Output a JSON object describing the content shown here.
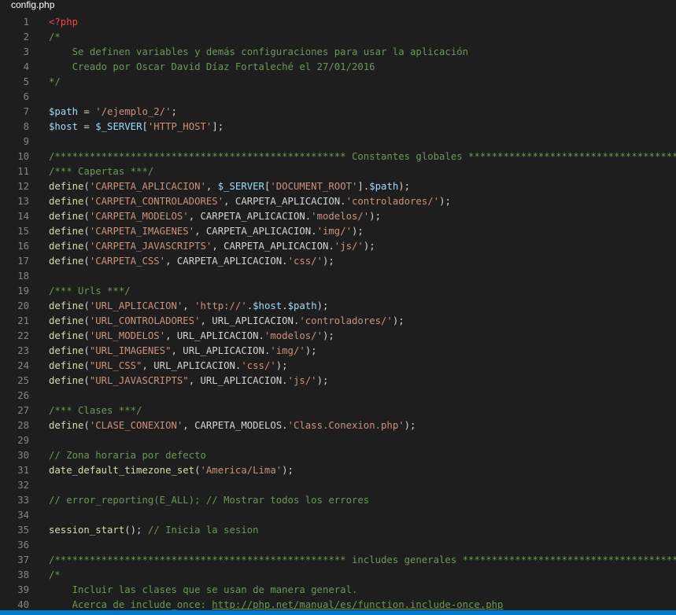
{
  "tab": {
    "title": "config.php"
  },
  "colors": {
    "background": "#1e1e1e",
    "line_number": "#858585",
    "comment": "#6a9955",
    "string": "#ce9178",
    "variable": "#9cdcfe",
    "php_tag": "#f44747",
    "function": "#dcdcaa",
    "text": "#d4d4d4",
    "statusbar": "#007acc"
  },
  "lines": [
    {
      "n": "1",
      "tokens": [
        [
          "tag",
          "<?php"
        ]
      ]
    },
    {
      "n": "2",
      "tokens": [
        [
          "cmt",
          "/*"
        ]
      ]
    },
    {
      "n": "3",
      "tokens": [
        [
          "cmt",
          "    Se definen variables y demás configuraciones para usar la aplicación"
        ]
      ]
    },
    {
      "n": "4",
      "tokens": [
        [
          "cmt",
          "    Creado por Oscar David Díaz Fortaleché el 27/01/2016"
        ]
      ]
    },
    {
      "n": "5",
      "tokens": [
        [
          "cmt",
          "*/"
        ]
      ]
    },
    {
      "n": "6",
      "tokens": []
    },
    {
      "n": "7",
      "tokens": [
        [
          "var",
          "$path"
        ],
        [
          "op",
          " = "
        ],
        [
          "str",
          "'/ejemplo_2/'"
        ],
        [
          "op",
          ";"
        ]
      ]
    },
    {
      "n": "8",
      "tokens": [
        [
          "var",
          "$host"
        ],
        [
          "op",
          " = "
        ],
        [
          "var",
          "$_SERVER"
        ],
        [
          "op",
          "["
        ],
        [
          "str",
          "'HTTP_HOST'"
        ],
        [
          "op",
          "];"
        ]
      ]
    },
    {
      "n": "9",
      "tokens": []
    },
    {
      "n": "10",
      "tokens": [
        [
          "cmt",
          "/************************************************** Constantes globales **************************************************/"
        ]
      ]
    },
    {
      "n": "11",
      "tokens": [
        [
          "cmt",
          "/*** Capertas ***/"
        ]
      ]
    },
    {
      "n": "12",
      "tokens": [
        [
          "fn",
          "define"
        ],
        [
          "op",
          "("
        ],
        [
          "str",
          "'CARPETA_APLICACION'"
        ],
        [
          "op",
          ", "
        ],
        [
          "var",
          "$_SERVER"
        ],
        [
          "op",
          "["
        ],
        [
          "str",
          "'DOCUMENT_ROOT'"
        ],
        [
          "op",
          "]."
        ],
        [
          "var",
          "$path"
        ],
        [
          "op",
          ");"
        ]
      ]
    },
    {
      "n": "13",
      "tokens": [
        [
          "fn",
          "define"
        ],
        [
          "op",
          "("
        ],
        [
          "str",
          "'CARPETA_CONTROLADORES'"
        ],
        [
          "op",
          ", CARPETA_APLICACION."
        ],
        [
          "str",
          "'controladores/'"
        ],
        [
          "op",
          ");"
        ]
      ]
    },
    {
      "n": "14",
      "tokens": [
        [
          "fn",
          "define"
        ],
        [
          "op",
          "("
        ],
        [
          "str",
          "'CARPETA_MODELOS'"
        ],
        [
          "op",
          ", CARPETA_APLICACION."
        ],
        [
          "str",
          "'modelos/'"
        ],
        [
          "op",
          ");"
        ]
      ]
    },
    {
      "n": "15",
      "tokens": [
        [
          "fn",
          "define"
        ],
        [
          "op",
          "("
        ],
        [
          "str",
          "'CARPETA_IMAGENES'"
        ],
        [
          "op",
          ", CARPETA_APLICACION."
        ],
        [
          "str",
          "'img/'"
        ],
        [
          "op",
          ");"
        ]
      ]
    },
    {
      "n": "16",
      "tokens": [
        [
          "fn",
          "define"
        ],
        [
          "op",
          "("
        ],
        [
          "str",
          "'CARPETA_JAVASCRIPTS'"
        ],
        [
          "op",
          ", CARPETA_APLICACION."
        ],
        [
          "str",
          "'js/'"
        ],
        [
          "op",
          ");"
        ]
      ]
    },
    {
      "n": "17",
      "tokens": [
        [
          "fn",
          "define"
        ],
        [
          "op",
          "("
        ],
        [
          "str",
          "'CARPETA_CSS'"
        ],
        [
          "op",
          ", CARPETA_APLICACION."
        ],
        [
          "str",
          "'css/'"
        ],
        [
          "op",
          ");"
        ]
      ]
    },
    {
      "n": "18",
      "tokens": []
    },
    {
      "n": "19",
      "tokens": [
        [
          "cmt",
          "/*** Urls ***/"
        ]
      ]
    },
    {
      "n": "20",
      "tokens": [
        [
          "fn",
          "define"
        ],
        [
          "op",
          "("
        ],
        [
          "str",
          "'URL_APLICACION'"
        ],
        [
          "op",
          ", "
        ],
        [
          "str",
          "'http://'"
        ],
        [
          "op",
          "."
        ],
        [
          "var",
          "$host"
        ],
        [
          "op",
          "."
        ],
        [
          "var",
          "$path"
        ],
        [
          "op",
          ");"
        ]
      ]
    },
    {
      "n": "21",
      "tokens": [
        [
          "fn",
          "define"
        ],
        [
          "op",
          "("
        ],
        [
          "str",
          "'URL_CONTROLADORES'"
        ],
        [
          "op",
          ", URL_APLICACION."
        ],
        [
          "str",
          "'controladores/'"
        ],
        [
          "op",
          ");"
        ]
      ]
    },
    {
      "n": "22",
      "tokens": [
        [
          "fn",
          "define"
        ],
        [
          "op",
          "("
        ],
        [
          "str",
          "'URL_MODELOS'"
        ],
        [
          "op",
          ", URL_APLICACION."
        ],
        [
          "str",
          "'modelos/'"
        ],
        [
          "op",
          ");"
        ]
      ]
    },
    {
      "n": "23",
      "tokens": [
        [
          "fn",
          "define"
        ],
        [
          "op",
          "("
        ],
        [
          "str",
          "\"URL_IMAGENES\""
        ],
        [
          "op",
          ", URL_APLICACION."
        ],
        [
          "str",
          "'img/'"
        ],
        [
          "op",
          ");"
        ]
      ]
    },
    {
      "n": "24",
      "tokens": [
        [
          "fn",
          "define"
        ],
        [
          "op",
          "("
        ],
        [
          "str",
          "\"URL_CSS\""
        ],
        [
          "op",
          ", URL_APLICACION."
        ],
        [
          "str",
          "'css/'"
        ],
        [
          "op",
          ");"
        ]
      ]
    },
    {
      "n": "25",
      "tokens": [
        [
          "fn",
          "define"
        ],
        [
          "op",
          "("
        ],
        [
          "str",
          "\"URL_JAVASCRIPTS\""
        ],
        [
          "op",
          ", URL_APLICACION."
        ],
        [
          "str",
          "'js/'"
        ],
        [
          "op",
          ");"
        ]
      ]
    },
    {
      "n": "26",
      "tokens": []
    },
    {
      "n": "27",
      "tokens": [
        [
          "cmt",
          "/*** Clases ***/"
        ]
      ]
    },
    {
      "n": "28",
      "tokens": [
        [
          "fn",
          "define"
        ],
        [
          "op",
          "("
        ],
        [
          "str",
          "'CLASE_CONEXION'"
        ],
        [
          "op",
          ", CARPETA_MODELOS."
        ],
        [
          "str",
          "'Class.Conexion.php'"
        ],
        [
          "op",
          ");"
        ]
      ]
    },
    {
      "n": "29",
      "tokens": []
    },
    {
      "n": "30",
      "tokens": [
        [
          "cmt",
          "// Zona horaria por defecto"
        ]
      ]
    },
    {
      "n": "31",
      "tokens": [
        [
          "fn",
          "date_default_timezone_set"
        ],
        [
          "op",
          "("
        ],
        [
          "str",
          "'America/Lima'"
        ],
        [
          "op",
          ");"
        ]
      ]
    },
    {
      "n": "32",
      "tokens": []
    },
    {
      "n": "33",
      "tokens": [
        [
          "cmt",
          "// error_reporting(E_ALL); // Mostrar todos los errores"
        ]
      ]
    },
    {
      "n": "34",
      "tokens": []
    },
    {
      "n": "35",
      "tokens": [
        [
          "fn",
          "session_start"
        ],
        [
          "op",
          "(); "
        ],
        [
          "cmt",
          "// Inicia la sesion"
        ]
      ]
    },
    {
      "n": "36",
      "tokens": []
    },
    {
      "n": "37",
      "tokens": [
        [
          "cmt",
          "/************************************************** includes generales **************************************************/"
        ]
      ]
    },
    {
      "n": "38",
      "tokens": [
        [
          "cmt",
          "/*"
        ]
      ]
    },
    {
      "n": "39",
      "tokens": [
        [
          "cmt",
          "    Incluir las clases que se usan de manera general."
        ]
      ]
    },
    {
      "n": "40",
      "tokens": [
        [
          "cmt",
          "    Acerca de include_once: "
        ],
        [
          "link",
          "http://php.net/manual/es/function.include-once.php"
        ]
      ]
    }
  ]
}
